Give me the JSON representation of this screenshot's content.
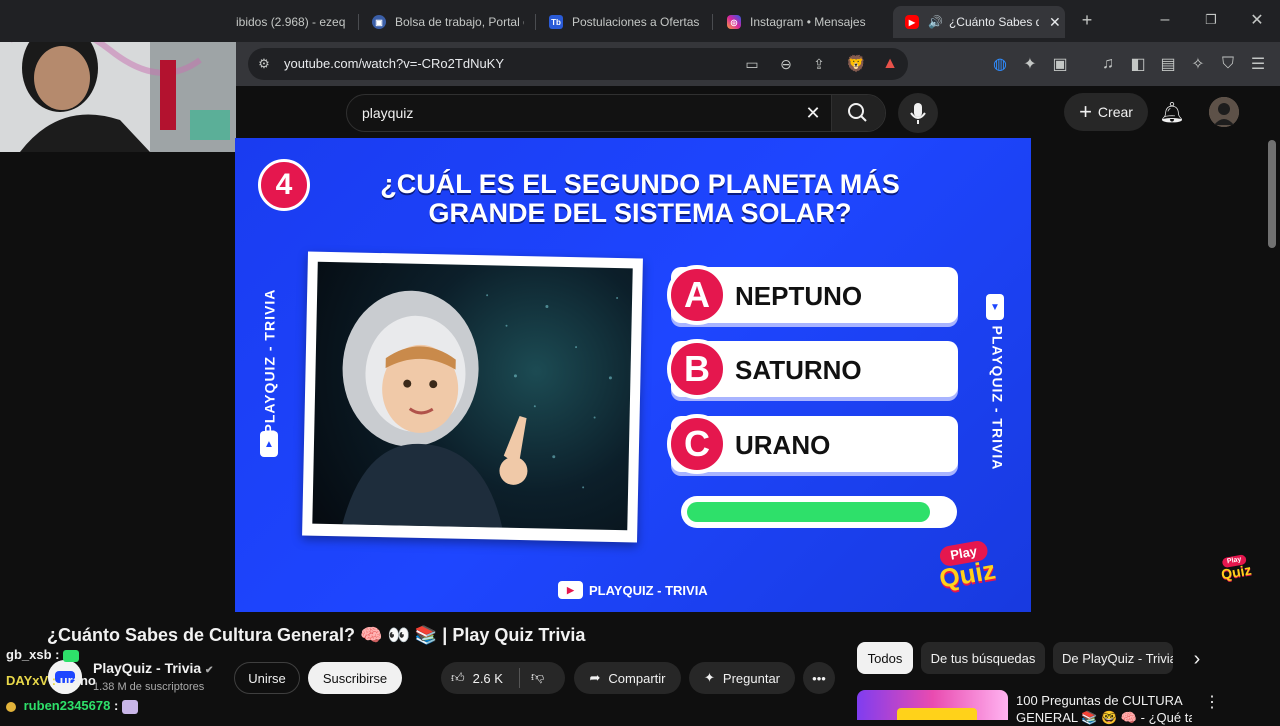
{
  "browser": {
    "tabs": [
      {
        "title": "ibidos (2.968) - ezeq",
        "favicon": "mail",
        "active": false
      },
      {
        "title": "Bolsa de trabajo, Portal d",
        "favicon": "briefcase",
        "active": false
      },
      {
        "title": "Postulaciones a Ofertas",
        "favicon": "Tb",
        "active": false
      },
      {
        "title": "Instagram • Mensajes",
        "favicon": "instagram",
        "active": false
      },
      {
        "title": "¿Cuánto Sabes d",
        "favicon": "youtube",
        "active": true
      }
    ],
    "url": "youtube.com/watch?v=-CRo2TdNuKY"
  },
  "youtube": {
    "search_value": "playquiz",
    "create_label": "Crear"
  },
  "video": {
    "question_number": "4",
    "question_line1": "¿CUÁL ES EL SEGUNDO PLANETA MÁS",
    "question_line2": "GRANDE DEL SISTEMA SOLAR?",
    "options": [
      {
        "letter": "A",
        "text": "NEPTUNO"
      },
      {
        "letter": "B",
        "text": "SATURNO"
      },
      {
        "letter": "C",
        "text": "URANO"
      }
    ],
    "timer_progress": 0.92,
    "side_label": "PLAYQUIZ - TRIVIA",
    "bottom_label": "PLAYQUIZ - TRIVIA",
    "logo_line1": "Play",
    "logo_line2": "Quiz"
  },
  "watch": {
    "title": "¿Cuánto Sabes de Cultura General? 🧠 👀 📚 | Play Quiz Trivia",
    "channel_name": "PlayQuiz - Trivia",
    "subscribers": "1.38 M de suscriptores",
    "join_label": "Unirse",
    "subscribe_label": "Suscribirse",
    "likes": "2.6 K",
    "share_label": "Compartir",
    "ask_label": "Preguntar",
    "chips": [
      "Todos",
      "De tus búsquedas",
      "De PlayQuiz - Trivia"
    ],
    "related_title_1": "100 Preguntas de CULTURA",
    "related_title_2": "GENERAL 📚 🤓 🧠 - ¿Qué tan"
  },
  "chat": [
    {
      "user": "gb_xsb",
      "message": ""
    },
    {
      "user": "DAYxV",
      "message": "urano"
    },
    {
      "user": "ruben2345678",
      "message": ""
    }
  ],
  "colors": {
    "video_bg": "#1e46ff",
    "accent_red": "#e5174e",
    "timer_green": "#2ee06a"
  }
}
